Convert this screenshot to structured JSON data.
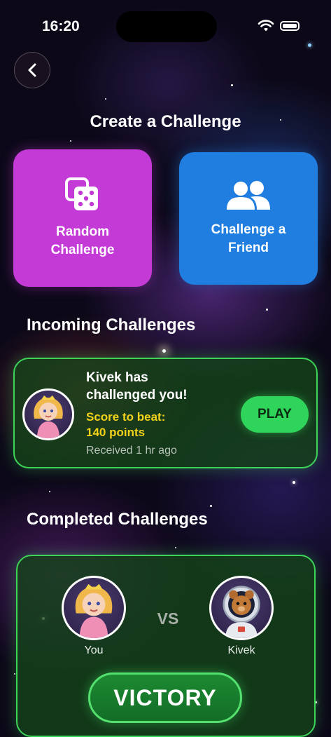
{
  "status_bar": {
    "time": "16:20"
  },
  "header": {
    "back_icon": "chevron-left-icon"
  },
  "create": {
    "title": "Create a Challenge",
    "random_label": "Random Challenge",
    "random_icon": "dice-icon",
    "random_color": "#c43ad6",
    "friend_label": "Challenge a Friend",
    "friend_icon": "users-icon",
    "friend_color": "#1f7ee0"
  },
  "incoming": {
    "title": "Incoming Challenges",
    "message": "Kivek has challenged you!",
    "score_label": "Score to beat:",
    "score_value": "140 points",
    "received": "Received 1 hr ago",
    "play_label": "PLAY",
    "accent": "#2fd45a"
  },
  "completed": {
    "title": "Completed Challenges",
    "player_name": "You",
    "opponent_name": "Kivek",
    "vs_label": "VS",
    "result": "VICTORY"
  }
}
